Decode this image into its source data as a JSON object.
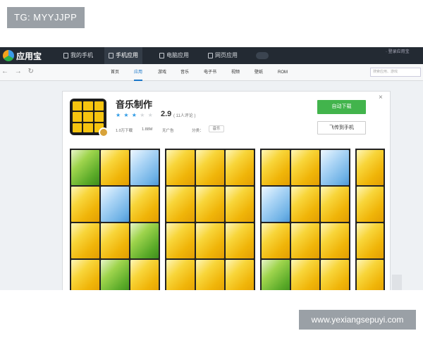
{
  "watermarks": {
    "top": "TG: MYYJJPP",
    "bottom": "www.yexiangsepuyi.com"
  },
  "topbar": {
    "app_name": "应用宝",
    "tabs": [
      {
        "label": "我的手机",
        "active": false
      },
      {
        "label": "手机应用",
        "active": true
      },
      {
        "label": "电脑应用",
        "active": false
      },
      {
        "label": "网页应用",
        "active": false
      }
    ],
    "user_text": "· 登录应用宝"
  },
  "subbar": {
    "nav": "← → ↻",
    "categories": [
      {
        "label": "首页",
        "active": false
      },
      {
        "label": "应用",
        "active": true
      },
      {
        "label": "游戏",
        "active": false
      },
      {
        "label": "音乐",
        "active": false
      },
      {
        "label": "电子书",
        "active": false
      },
      {
        "label": "视频",
        "active": false
      },
      {
        "label": "壁纸",
        "active": false
      },
      {
        "label": "ROM",
        "active": false
      }
    ],
    "search_placeholder": "搜索应用、游戏"
  },
  "detail": {
    "close": "×",
    "title": "音乐制作",
    "stars_on": "★ ★ ★",
    "stars_off": "★ ★",
    "rating": "2.9",
    "reviews": "( 11人评论 )",
    "downloads": "1.0万下载",
    "size": "1.88M",
    "ads": "无广告",
    "category_label": "分类：",
    "category_value": "音乐",
    "download_button": "自动下载",
    "phone_button": "飞传到手机"
  },
  "screenshots": [
    [
      "g",
      "y",
      "b",
      "y",
      "b",
      "y",
      "y",
      "y",
      "g",
      "y",
      "g",
      "y"
    ],
    [
      "y",
      "y",
      "y",
      "y",
      "y",
      "y",
      "y",
      "y",
      "y",
      "y",
      "y",
      "y"
    ],
    [
      "y",
      "y",
      "b",
      "b",
      "y",
      "y",
      "y",
      "y",
      "y",
      "g",
      "y",
      "y"
    ],
    [
      "y",
      "y",
      "y",
      "y"
    ]
  ],
  "colors": {
    "accent": "#1b77c9",
    "download_green": "#42b44c",
    "topbar": "#232a33"
  }
}
